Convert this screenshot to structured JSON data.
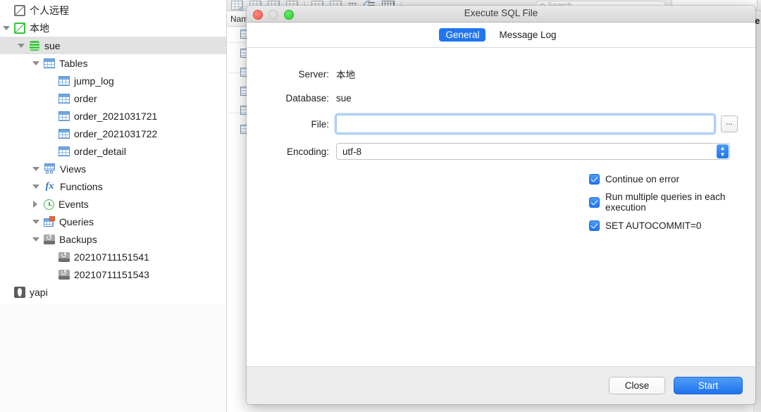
{
  "background": {
    "column_header": "Nam",
    "search_placeholder": "Search",
    "right_edge_text": "le",
    "toolbar_icons": [
      "table-new-icon",
      "table-edit-icon",
      "table-import-icon",
      "table-export-icon",
      "table-open-icon",
      "table-design-icon",
      "grid-dots-icon",
      "filter-sort-icon",
      "table-grid-icon"
    ]
  },
  "sidebar": {
    "items": [
      {
        "label": "个人远程",
        "icon": "connection-icon",
        "indent": 0,
        "twisty": "none",
        "selected": false
      },
      {
        "label": "本地",
        "icon": "connection-green-icon",
        "indent": 0,
        "twisty": "down",
        "selected": false
      },
      {
        "label": "sue",
        "icon": "database-icon",
        "indent": 1,
        "twisty": "down",
        "selected": true
      },
      {
        "label": "Tables",
        "icon": "tables-folder-icon",
        "indent": 2,
        "twisty": "down",
        "selected": false
      },
      {
        "label": "jump_log",
        "icon": "table-icon",
        "indent": 3,
        "twisty": "none",
        "selected": false
      },
      {
        "label": "order",
        "icon": "table-icon",
        "indent": 3,
        "twisty": "none",
        "selected": false
      },
      {
        "label": "order_2021031721",
        "icon": "table-icon",
        "indent": 3,
        "twisty": "none",
        "selected": false
      },
      {
        "label": "order_2021031722",
        "icon": "table-icon",
        "indent": 3,
        "twisty": "none",
        "selected": false
      },
      {
        "label": "order_detail",
        "icon": "table-icon",
        "indent": 3,
        "twisty": "none",
        "selected": false
      },
      {
        "label": "Views",
        "icon": "views-icon",
        "indent": 2,
        "twisty": "down",
        "selected": false
      },
      {
        "label": "Functions",
        "icon": "functions-icon",
        "indent": 2,
        "twisty": "down",
        "selected": false
      },
      {
        "label": "Events",
        "icon": "events-clock-icon",
        "indent": 2,
        "twisty": "right",
        "selected": false
      },
      {
        "label": "Queries",
        "icon": "queries-icon",
        "indent": 2,
        "twisty": "down",
        "selected": false
      },
      {
        "label": "Backups",
        "icon": "backups-icon",
        "indent": 2,
        "twisty": "down",
        "selected": false
      },
      {
        "label": "20210711151541",
        "icon": "backup-file-icon",
        "indent": 3,
        "twisty": "none",
        "selected": false
      },
      {
        "label": "20210711151543",
        "icon": "backup-file-icon",
        "indent": 3,
        "twisty": "none",
        "selected": false
      },
      {
        "label": "yapi",
        "icon": "yapi-connection-icon",
        "indent": 0,
        "twisty": "none",
        "selected": false
      }
    ]
  },
  "dialog": {
    "title": "Execute SQL File",
    "window_controls": {
      "close": "close-button",
      "minimize": "minimize-button",
      "zoom": "zoom-button"
    },
    "tabs": [
      {
        "label": "General",
        "active": true
      },
      {
        "label": "Message Log",
        "active": false
      }
    ],
    "form": {
      "server_label": "Server:",
      "server_value": "本地",
      "database_label": "Database:",
      "database_value": "sue",
      "file_label": "File:",
      "file_value": "",
      "file_placeholder": "",
      "browse_label": "...",
      "encoding_label": "Encoding:",
      "encoding_value": "utf-8"
    },
    "options": [
      {
        "label": "Continue on error",
        "checked": true
      },
      {
        "label": "Run multiple queries in each execution",
        "checked": true
      },
      {
        "label": "SET AUTOCOMMIT=0",
        "checked": true
      }
    ],
    "footer": {
      "close_label": "Close",
      "start_label": "Start"
    }
  },
  "colors": {
    "accent_blue": "#2176f0",
    "focus_ring": "#78afeb",
    "selected_row": "#e2e2e2",
    "footer_bg": "#ececec"
  }
}
